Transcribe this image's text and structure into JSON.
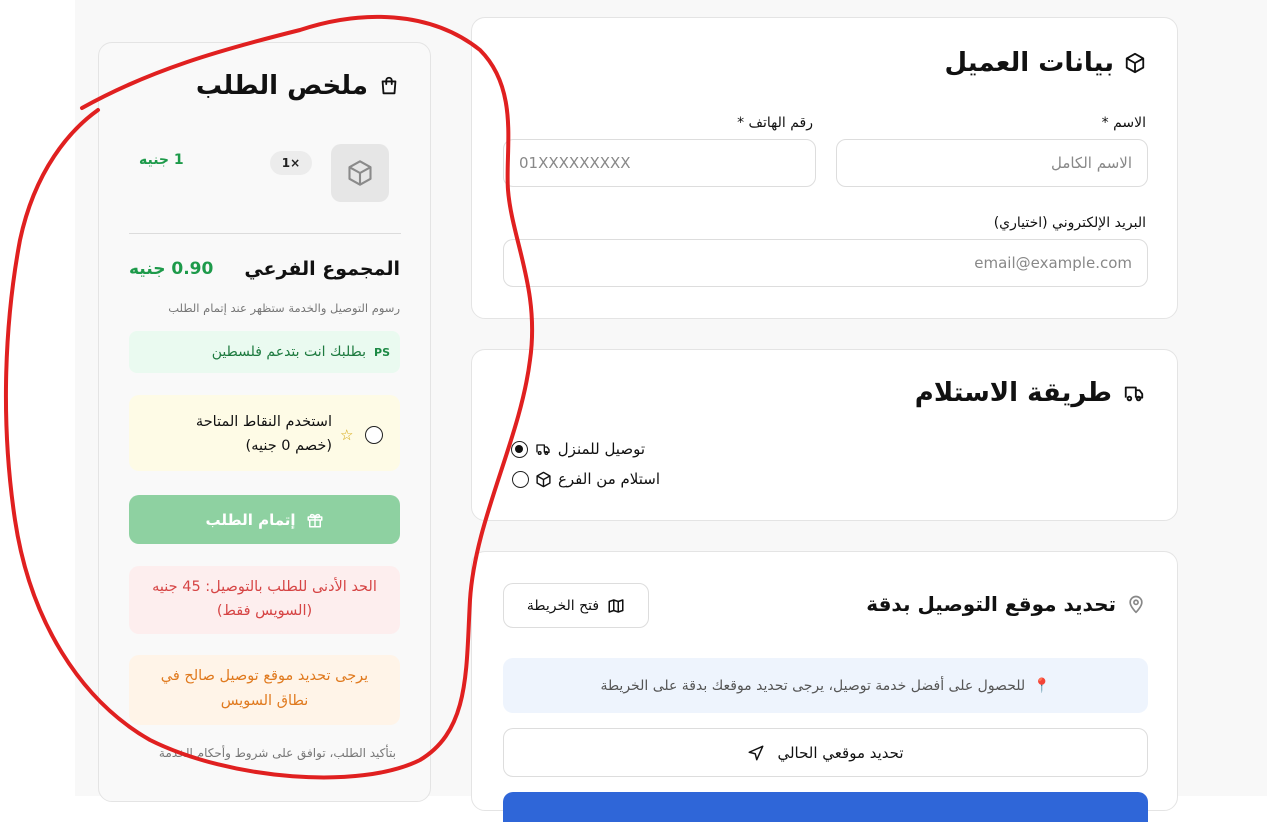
{
  "summary": {
    "title": "ملخص الطلب",
    "item": {
      "qty": "1×",
      "price": "1 جنيه"
    },
    "subtotal_label": "المجموع الفرعي",
    "subtotal_value": "0.90 جنيه",
    "fee_note": "رسوم التوصيل والخدمة ستظهر عند إتمام الطلب",
    "ps_code": "PS",
    "ps_text": "بطلبك انت بتدعم فلسطين",
    "points_line1": "استخدم النقاط المتاحة",
    "points_line2": "(خصم 0 جنيه)",
    "checkout_label": "إتمام الطلب",
    "min_order_line1": "الحد الأدنى للطلب بالتوصيل: 45 جنيه",
    "min_order_line2": "(السويس فقط)",
    "location_warning_line1": "يرجى تحديد موقع توصيل صالح في",
    "location_warning_line2": "نطاق السويس",
    "terms": "بتأكيد الطلب، توافق على شروط وأحكام الخدمة"
  },
  "customer": {
    "title": "بيانات العميل",
    "name_label": "الاسم *",
    "name_placeholder": "الاسم الكامل",
    "phone_label": "رقم الهاتف *",
    "phone_placeholder": "01XXXXXXXXX",
    "email_label": "البريد الإلكتروني (اختياري)",
    "email_placeholder": "email@example.com"
  },
  "delivery_method": {
    "title": "طريقة الاستلام",
    "options": [
      {
        "label": "توصيل للمنزل",
        "selected": true
      },
      {
        "label": "استلام من الفرع",
        "selected": false
      }
    ]
  },
  "location": {
    "title": "تحديد موقع التوصيل بدقة",
    "map_button": "فتح الخريطة",
    "info": "للحصول على أفضل خدمة توصيل، يرجى تحديد موقعك بدقة على الخريطة",
    "locate_button": "تحديد موقعي الحالي"
  },
  "colors": {
    "green": "#1d9a4a",
    "checkout_button": "#8ed1a1",
    "alert_red": "#d64545",
    "alert_orange": "#e07a1f",
    "primary_blue": "#2f66d8",
    "annotation_red": "#e02020"
  }
}
